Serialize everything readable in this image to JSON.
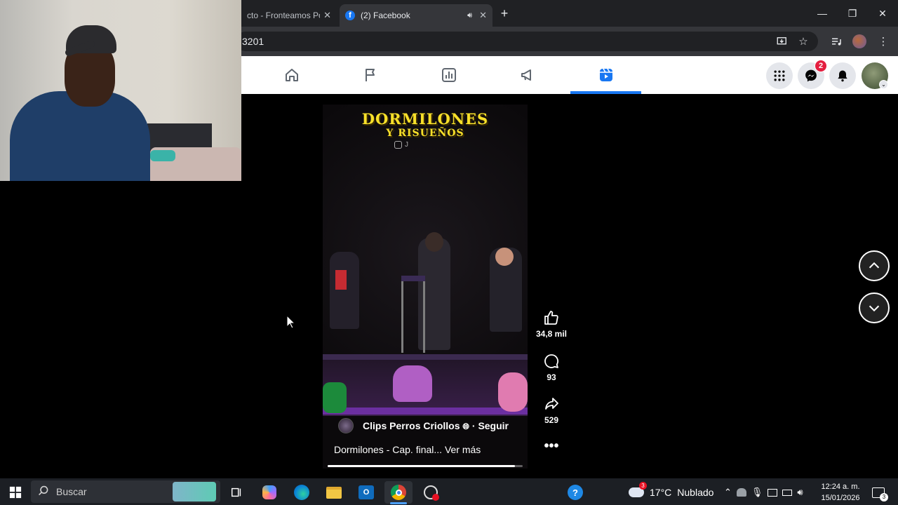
{
  "browser": {
    "tabs": [
      {
        "title": "cto - Fronteamos Por",
        "active": false
      },
      {
        "title": "(2) Facebook",
        "active": true
      }
    ],
    "url_fragment": "3201"
  },
  "facebook_nav": {
    "items": [
      "home-icon",
      "flag-icon",
      "chart-icon",
      "megaphone-icon",
      "reels-icon"
    ],
    "active": "reels-icon",
    "messenger_badge": "2"
  },
  "video": {
    "title_line1": "DORMILONES",
    "title_line2": "Y RISUEÑOS",
    "instagram_tag": "J",
    "author": "Clips Perros Criollos",
    "follow": "Seguir",
    "caption": "Dormilones - Cap. final...",
    "see_more": "Ver más",
    "progress": 0.96
  },
  "actions": {
    "likes": "34,8 mil",
    "comments": "93",
    "shares": "529"
  },
  "taskbar": {
    "search_placeholder": "Buscar",
    "weather_temp": "17°C",
    "weather_desc": "Nublado",
    "weather_badge": "3",
    "time": "12:24 a. m.",
    "date": "15/01/2026",
    "notification_count": "3"
  },
  "colors": {
    "fb_blue": "#1877f2",
    "title_yellow": "#f7e02a",
    "badge_red": "#e41e3f"
  }
}
